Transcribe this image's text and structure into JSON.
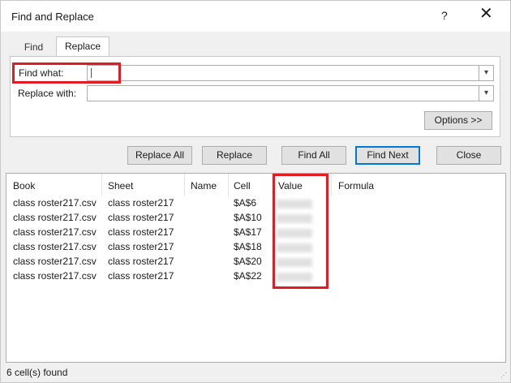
{
  "window": {
    "title": "Find and Replace",
    "help": "?",
    "close": "✕"
  },
  "tabs": [
    {
      "label": "Find"
    },
    {
      "label": "Replace"
    }
  ],
  "find": {
    "label": "Find what:",
    "value": ""
  },
  "replace": {
    "label": "Replace with:",
    "value": ""
  },
  "buttons": {
    "options": "Options >>",
    "replace_all": "Replace All",
    "replace": "Replace",
    "find_all": "Find All",
    "find_next": "Find Next",
    "close": "Close"
  },
  "results": {
    "columns": [
      "Book",
      "Sheet",
      "Name",
      "Cell",
      "Value",
      "Formula"
    ],
    "rows": [
      {
        "book": "class roster217.csv",
        "sheet": "class roster217",
        "cell": "$A$6"
      },
      {
        "book": "class roster217.csv",
        "sheet": "class roster217",
        "cell": "$A$10"
      },
      {
        "book": "class roster217.csv",
        "sheet": "class roster217",
        "cell": "$A$17"
      },
      {
        "book": "class roster217.csv",
        "sheet": "class roster217",
        "cell": "$A$18"
      },
      {
        "book": "class roster217.csv",
        "sheet": "class roster217",
        "cell": "$A$20"
      },
      {
        "book": "class roster217.csv",
        "sheet": "class roster217",
        "cell": "$A$22"
      }
    ]
  },
  "status": "6 cell(s) found",
  "colors": {
    "highlight": "#e31b23",
    "focus": "#0078d7"
  },
  "icons": {
    "dropdown": "chevron-down-icon",
    "close": "close-icon",
    "help": "help-icon"
  }
}
